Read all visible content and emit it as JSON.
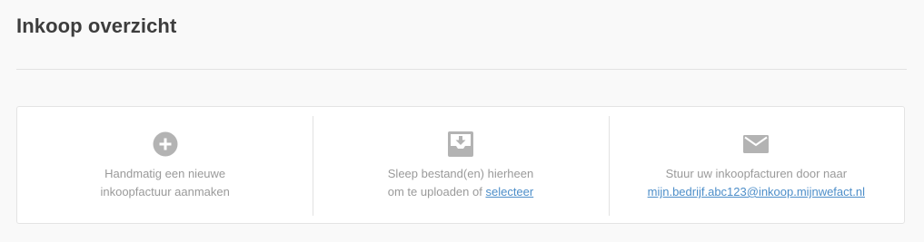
{
  "header": {
    "title": "Inkoop overzicht"
  },
  "actions": {
    "manual": {
      "icon": "plus-circle-icon",
      "line1": "Handmatig een nieuwe",
      "line2": "inkoopfactuur aanmaken"
    },
    "upload": {
      "icon": "inbox-download-icon",
      "line1": "Sleep bestand(en) hierheen",
      "line2_prefix": "om te uploaden of ",
      "link": "selecteer"
    },
    "email": {
      "icon": "envelope-icon",
      "line1": "Stuur uw inkoopfacturen door naar",
      "address": "mijn.bedrijf.abc123@inkoop.mijnwefact.nl"
    }
  },
  "colors": {
    "icon": "#b3b3b3",
    "link": "#4d8ec9",
    "title": "#3d3d3d",
    "text": "#9a9a9a"
  }
}
